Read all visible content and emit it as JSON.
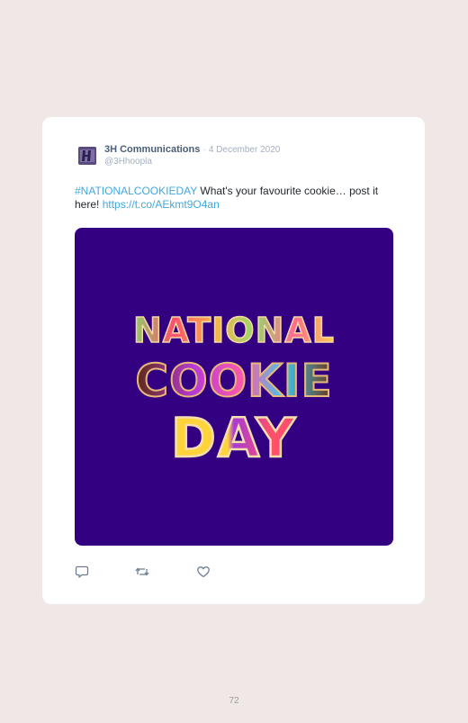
{
  "tweet": {
    "author_name": "3H Communications",
    "separator": "·",
    "date": "4 December 2020",
    "handle": "@3Hhoopla",
    "hashtag": "#NATIONALCOOKIEDAY",
    "text_main": " What's your favourite cookie… post it here! ",
    "link": "https://t.co/AEkmt9O4an",
    "media": {
      "background_color": "#340082",
      "line1": "NATIONAL",
      "line2": "COOKIE",
      "line3": "DAY"
    },
    "actions": [
      {
        "icon": "reply-icon"
      },
      {
        "icon": "retweet-icon"
      },
      {
        "icon": "like-icon"
      }
    ]
  },
  "page": {
    "number": "72"
  },
  "colors": {
    "page_background": "#efe8e6",
    "card_background": "#ffffff",
    "link": "#41a8df",
    "author": "#4a5e78",
    "muted": "#a4b0bf"
  }
}
